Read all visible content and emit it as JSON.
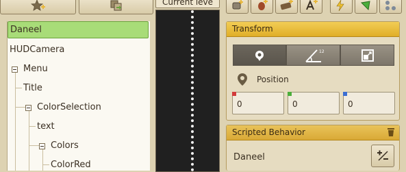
{
  "viewport": {
    "label": "Current leve"
  },
  "hierarchy": {
    "items": [
      {
        "label": "Daneel",
        "selected": true
      },
      {
        "label": "HUDCamera"
      },
      {
        "label": "Menu",
        "expanded": true
      },
      {
        "label": "Title"
      },
      {
        "label": "ColorSelection",
        "expanded": true
      },
      {
        "label": "text"
      },
      {
        "label": "Colors",
        "expanded": true
      },
      {
        "label": "ColorRed"
      }
    ]
  },
  "transform": {
    "title": "Transform",
    "tabs": [
      {
        "icon": "position-pin-icon",
        "active": true
      },
      {
        "icon": "rotation-angle-icon",
        "active": false
      },
      {
        "icon": "scale-box-icon",
        "active": false
      }
    ],
    "section_label": "Position",
    "fields": [
      {
        "value": "0",
        "color": "#d23b3b"
      },
      {
        "value": "0",
        "color": "#4cae3c"
      },
      {
        "value": "0",
        "color": "#3b6ed2"
      }
    ]
  },
  "scripted_behavior": {
    "title": "Scripted Behavior",
    "name": "Daneel"
  },
  "colors": {
    "accent": "#e8b73a",
    "selection": "#a8dc78",
    "viewport": "#202020"
  }
}
